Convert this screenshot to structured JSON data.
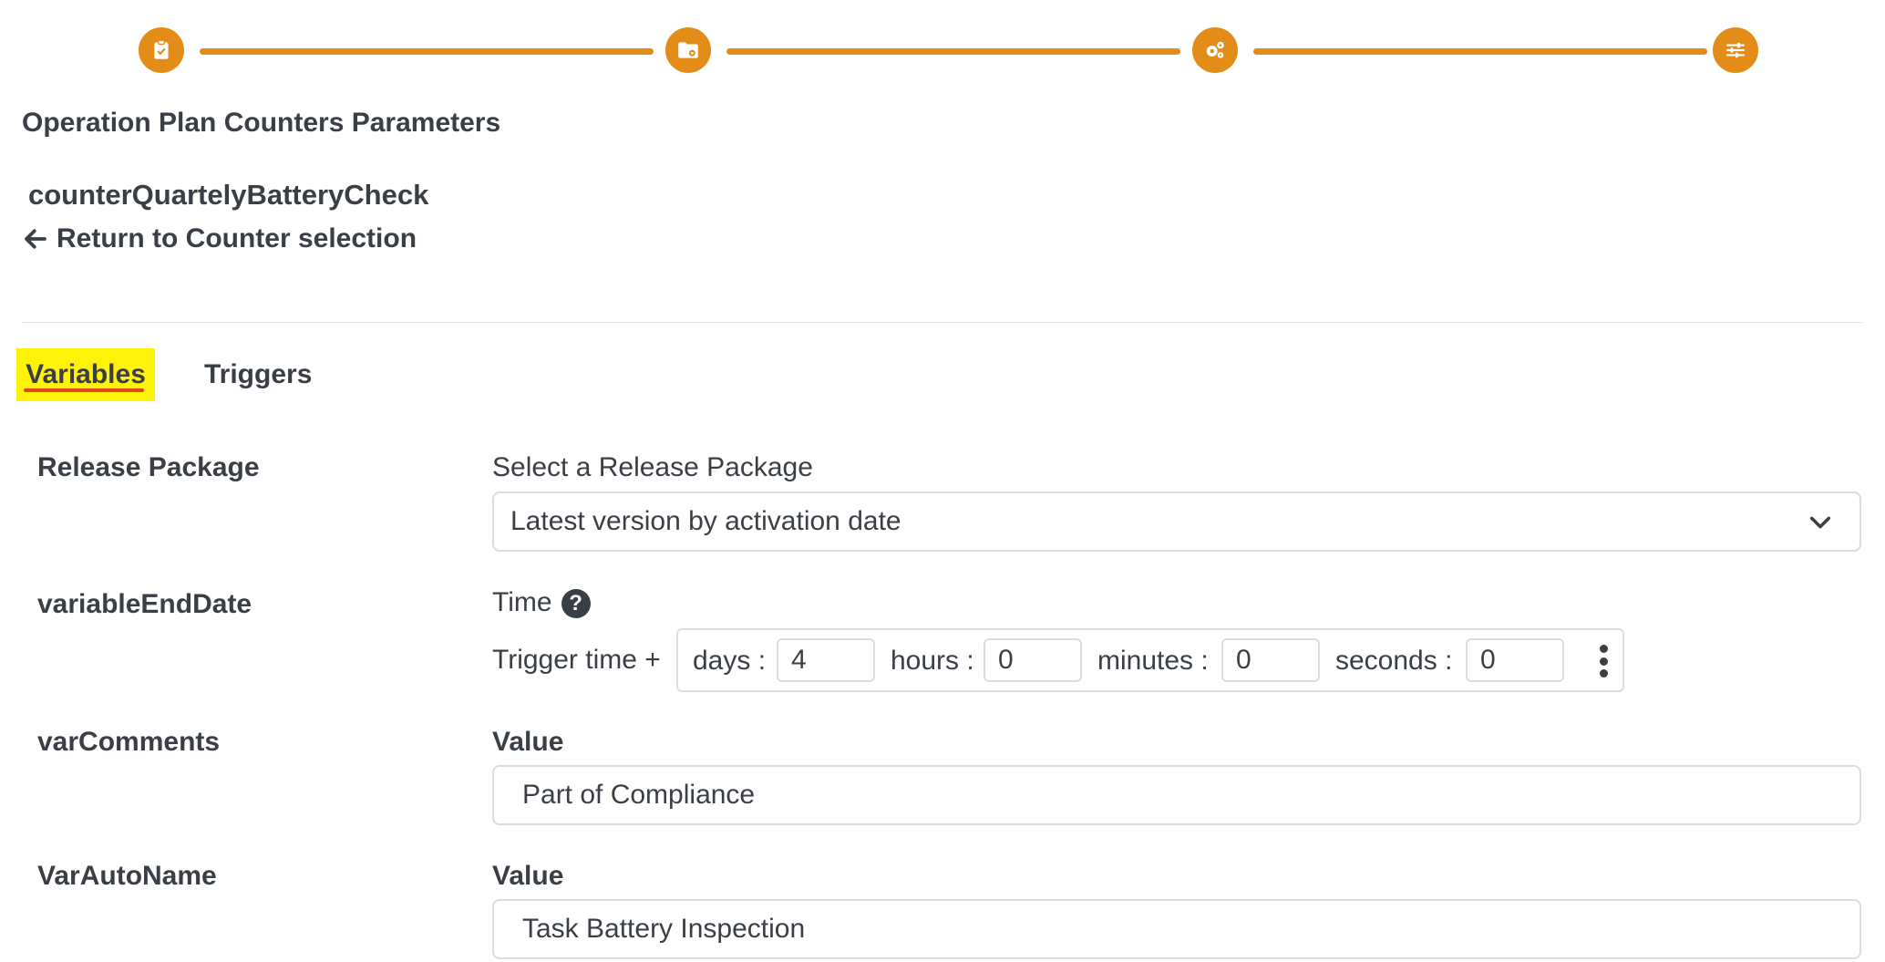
{
  "stepper": {
    "color": "#e38c17",
    "steps": [
      {
        "icon": "clipboard-check-icon"
      },
      {
        "icon": "folder-gear-icon"
      },
      {
        "icon": "gears-icon"
      },
      {
        "icon": "sliders-icon"
      }
    ]
  },
  "header": {
    "title": "Operation Plan Counters Parameters",
    "counter_name": "counterQuartelyBatteryCheck",
    "back_link": "Return to Counter selection"
  },
  "tabs": [
    {
      "label": "Variables",
      "active": true
    },
    {
      "label": "Triggers",
      "active": false
    }
  ],
  "release_package": {
    "label": "Release Package",
    "caption": "Select a Release Package",
    "selected": "Latest version by activation date"
  },
  "variable_end_date": {
    "label": "variableEndDate",
    "caption": "Time",
    "prefix": "Trigger time +",
    "days_label": "days :",
    "days_value": "4",
    "hours_label": "hours :",
    "hours_value": "0",
    "minutes_label": "minutes :",
    "minutes_value": "0",
    "seconds_label": "seconds :",
    "seconds_value": "0"
  },
  "var_comments": {
    "label": "varComments",
    "caption": "Value",
    "value": "Part of Compliance"
  },
  "var_auto_name": {
    "label": "VarAutoName",
    "caption": "Value",
    "value": "Task Battery Inspection"
  }
}
